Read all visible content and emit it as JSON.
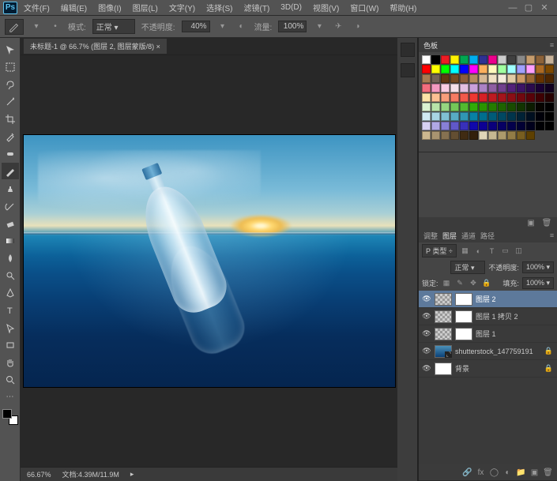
{
  "app": {
    "logo": "Ps"
  },
  "menu": {
    "file": "文件(F)",
    "edit": "编辑(E)",
    "image": "图像(I)",
    "layer": "图层(L)",
    "text": "文字(Y)",
    "select": "选择(S)",
    "filter": "滤镜(T)",
    "threeD": "3D(D)",
    "view": "视图(V)",
    "window": "窗口(W)",
    "help": "帮助(H)"
  },
  "optbar": {
    "mode_label": "模式:",
    "mode_value": "正常",
    "opacity_label": "不透明度:",
    "opacity_value": "40%",
    "flow_label": "流量:",
    "flow_value": "100%"
  },
  "doc": {
    "tab": "未标题-1 @ 66.7% (图层 2, 图层蒙版/8) ×",
    "zoom": "66.67%",
    "docinfo": "文档:4.39M/11.9M"
  },
  "panels": {
    "swatches_tab": "色板",
    "layers": {
      "tabs": {
        "adjust": "调整",
        "layer": "图层",
        "channel": "通道",
        "path": "路径"
      },
      "kind_label": "P 类型",
      "blend": "正常",
      "opacity_label": "不透明度:",
      "opacity_value": "100%",
      "lock_label": "锁定:",
      "fill_label": "填充:",
      "fill_value": "100%",
      "rows": [
        {
          "name": "图层 2"
        },
        {
          "name": "图层 1 拷贝 2"
        },
        {
          "name": "图层 1"
        },
        {
          "name": "shutterstock_147759191"
        },
        {
          "name": "背景"
        }
      ]
    }
  },
  "swatch_colors": [
    "#ffffff",
    "#000000",
    "#ed1c24",
    "#fff200",
    "#00a651",
    "#00aeef",
    "#2e3192",
    "#ec008c",
    "#cccccc",
    "#404040",
    "#898989",
    "#c69c6d",
    "#8c6239",
    "#c7b299",
    "#ff0000",
    "#ffff00",
    "#00ff00",
    "#00ffff",
    "#0000ff",
    "#ff00ff",
    "#fbaf5d",
    "#fff9bd",
    "#a0ffa0",
    "#a0ffff",
    "#a0a0ff",
    "#ffa0ff",
    "#ac6b25",
    "#7d4900",
    "#a67c52",
    "#736357",
    "#603913",
    "#754c24",
    "#8b5e3c",
    "#b28b5f",
    "#d5b895",
    "#f0e0c4",
    "#f4eadb",
    "#e2cba6",
    "#cc9966",
    "#996633",
    "#663300",
    "#4d2600",
    "#f26d7d",
    "#f49ac1",
    "#f9cde2",
    "#f5e1ea",
    "#e3bfe1",
    "#c9a0dc",
    "#ab82c5",
    "#8e5ea2",
    "#71408e",
    "#54217a",
    "#3d1466",
    "#2b0a4d",
    "#1a0033",
    "#10001f",
    "#fde3a7",
    "#fbc093",
    "#f89e7b",
    "#f57b63",
    "#f2594b",
    "#ef3733",
    "#d62027",
    "#bd1a21",
    "#a4141b",
    "#8b0e15",
    "#72080f",
    "#590209",
    "#3f0003",
    "#260000",
    "#daf2d0",
    "#b8e4a8",
    "#96d680",
    "#74c858",
    "#52ba30",
    "#30ac08",
    "#2a9400",
    "#247c00",
    "#1e6400",
    "#184c00",
    "#123400",
    "#0c1c00",
    "#060400",
    "#000000",
    "#d0eaf4",
    "#a8d5e4",
    "#80c0d4",
    "#58abc4",
    "#3096b4",
    "#0881a4",
    "#006e8e",
    "#005b78",
    "#004862",
    "#00354c",
    "#002236",
    "#000f20",
    "#000009",
    "#000000",
    "#d7d0f2",
    "#b0a8e4",
    "#8880d6",
    "#6058c8",
    "#3830ba",
    "#1008ac",
    "#0d0094",
    "#0a007c",
    "#070064",
    "#04004c",
    "#010034",
    "#00001c",
    "#000004",
    "#000000",
    "#ccb78f",
    "#a99470",
    "#867151",
    "#634e32",
    "#402b13",
    "#33200c",
    "#e0d6b8",
    "#c6b892",
    "#ac9a6c",
    "#927c46",
    "#785e20",
    "#5e4000"
  ]
}
